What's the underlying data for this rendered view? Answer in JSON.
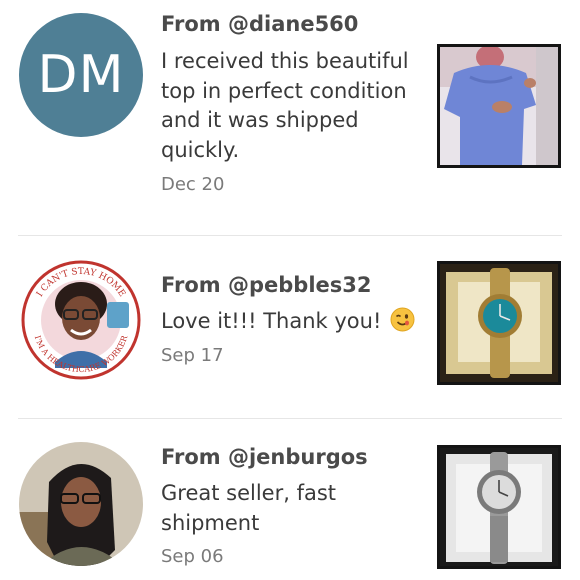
{
  "reviews": [
    {
      "avatar_initials": "DM",
      "from": "From @diane560",
      "text": "I received this beautiful top in perfect condition and it was shipped quickly.",
      "date": "Dec 20"
    },
    {
      "avatar_badge_text_top": "I CAN'T STAY HOME",
      "avatar_badge_text_bottom": "I'M A HEALTHCARE WORKER",
      "from": "From @pebbles32",
      "text": "Love it!!! Thank you!",
      "emoji": "winking-face-emoji",
      "date": "Sep 17"
    },
    {
      "from": "From @jenburgos",
      "text": "Great seller, fast shipment",
      "date": "Sep 06"
    }
  ],
  "colors": {
    "avatar_blue": "#4f7f95",
    "divider": "#e6e6e6",
    "date_gray": "#7a7a7a"
  }
}
